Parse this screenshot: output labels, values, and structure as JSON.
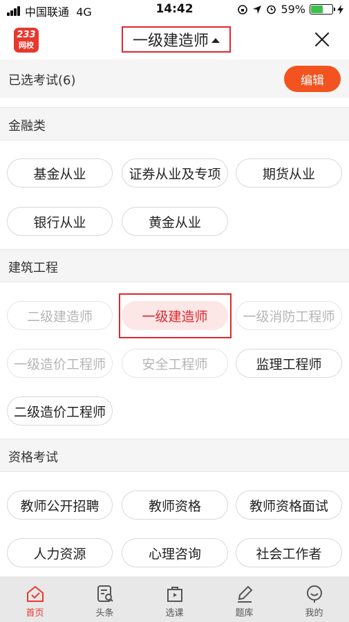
{
  "status_bar": {
    "carrier": "中国联通",
    "network": "4G",
    "time": "14:42",
    "battery": "59%",
    "battery_level": 0.59
  },
  "header": {
    "logo_top": "233",
    "logo_bottom": "网校",
    "title": "一级建造师",
    "close_icon": "close-icon"
  },
  "selected": {
    "label": "已选考试(6)",
    "edit_label": "编辑"
  },
  "sections": [
    {
      "title": "金融类",
      "items": [
        "基金从业",
        "证券从业及专项",
        "期货从业",
        "银行从业",
        "黄金从业"
      ]
    },
    {
      "title": "建筑工程",
      "items": [
        "二级建造师",
        "一级建造师",
        "一级消防工程师",
        "一级造价工程师",
        "安全工程师",
        "监理工程师",
        "二级造价工程师"
      ]
    },
    {
      "title": "资格考试",
      "items": [
        "教师公开招聘",
        "教师资格",
        "教师资格面试",
        "人力资源",
        "心理咨询",
        "社会工作者"
      ]
    }
  ],
  "tabs": [
    "首页",
    "头条",
    "选课",
    "题库",
    "我的"
  ],
  "colors": {
    "accent": "#e0262c",
    "edit_button": "#f2531f",
    "disabled_text": "#b6b6b6"
  }
}
